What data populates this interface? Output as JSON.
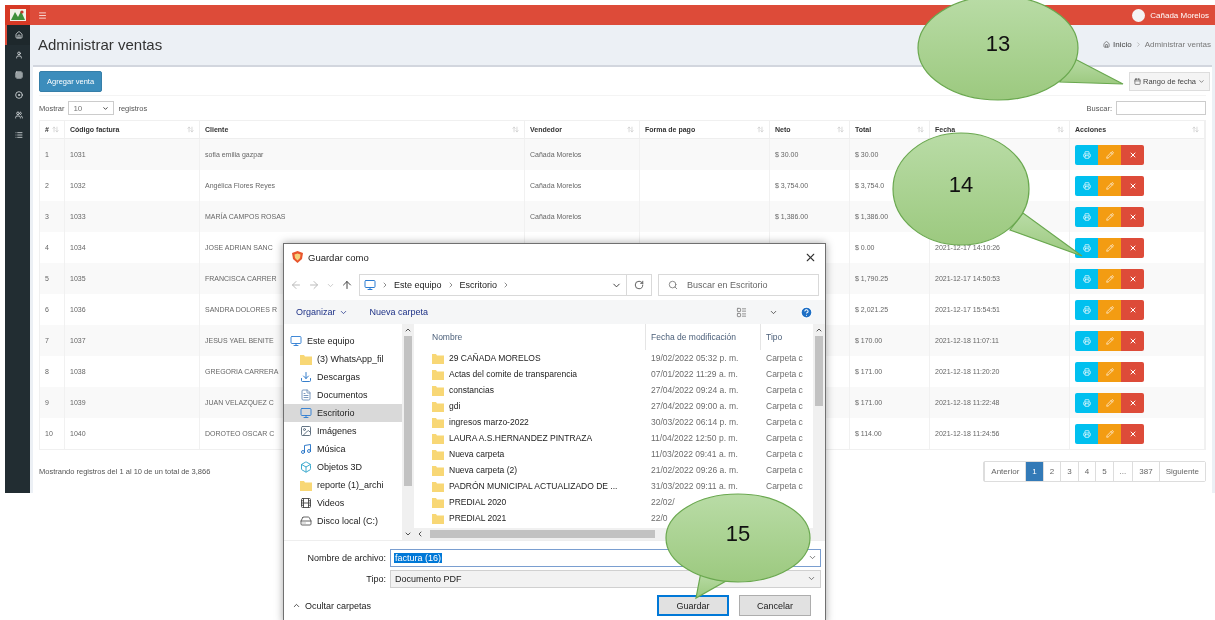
{
  "header": {
    "user": "Cañada Morelos"
  },
  "sidebar": {
    "items": [
      {
        "kind": "home",
        "selected": true
      },
      {
        "kind": "user",
        "selected": false
      },
      {
        "kind": "grid",
        "selected": false
      },
      {
        "kind": "disc",
        "selected": false
      },
      {
        "kind": "users",
        "selected": false
      },
      {
        "kind": "list",
        "selected": false
      }
    ]
  },
  "page": {
    "title": "Administrar ventas",
    "breadcrumb": [
      "Inicio",
      "Administrar ventas"
    ]
  },
  "toolbar": {
    "add_button": "Agregar venta",
    "date_range_button": "Rango de fecha"
  },
  "table_controls": {
    "show_label": "Mostrar",
    "page_size": "10",
    "records_label": "registros",
    "search_label": "Buscar:"
  },
  "table": {
    "columns": [
      "#",
      "Código factura",
      "Cliente",
      "Vendedor",
      "Forma de pago",
      "Neto",
      "Total",
      "Fecha",
      "Acciones"
    ],
    "rows": [
      {
        "number": "1",
        "code": "1031",
        "client": "sofia emilia gazpar",
        "seller": "Cañada Morelos",
        "net": "$ 30.00",
        "total": "$ 30.00"
      },
      {
        "number": "2",
        "code": "1032",
        "client": "Angélica Flores Reyes",
        "seller": "Cañada Morelos",
        "net": "$ 3,754.00",
        "total": "$ 3,754.0"
      },
      {
        "number": "3",
        "code": "1033",
        "client": "MARÍA CAMPOS ROSAS",
        "seller": "Cañada Morelos",
        "net": "$ 1,386.00",
        "total": "$ 1,386.00"
      },
      {
        "number": "4",
        "code": "1034",
        "client": "JOSE ADRIAN SANC",
        "total": "$ 0.00",
        "date": "2021-12-17 14:10:26"
      },
      {
        "number": "5",
        "code": "1035",
        "client": "FRANCISCA CARRER",
        "total": "$ 1,790.25",
        "date": "2021-12-17 14:50:53"
      },
      {
        "number": "6",
        "code": "1036",
        "client": "SANDRA DOLORES R",
        "total": "$ 2,021.25",
        "date": "2021-12-17 15:54:51"
      },
      {
        "number": "7",
        "code": "1037",
        "client": "JESUS YAEL BENITE",
        "total": "$ 170.00",
        "date": "2021-12-18 11:07:11"
      },
      {
        "number": "8",
        "code": "1038",
        "client": "GREGORIA CARRERA",
        "total": "$ 171.00",
        "date": "2021-12-18 11:20:20"
      },
      {
        "number": "9",
        "code": "1039",
        "client": "JUAN VELAZQUEZ C",
        "total": "$ 171.00",
        "date": "2021-12-18 11:22:48"
      },
      {
        "number": "10",
        "code": "1040",
        "client": "DOROTEO OSCAR C",
        "total": "$ 114.00",
        "date": "2021-12-18 11:24:56"
      }
    ]
  },
  "footer": {
    "info": "Mostrando registros del 1 al 10 de un total de 3,866",
    "pagination": [
      {
        "label": "Anterior",
        "selected": false
      },
      {
        "label": "1",
        "selected": true
      },
      {
        "label": "2",
        "selected": false
      },
      {
        "label": "3",
        "selected": false
      },
      {
        "label": "4",
        "selected": false
      },
      {
        "label": "5",
        "selected": false
      },
      {
        "label": "...",
        "selected": false
      },
      {
        "label": "387",
        "selected": false
      },
      {
        "label": "Siguiente",
        "selected": false
      }
    ]
  },
  "dialog": {
    "title": "Guardar como",
    "path": [
      "Este equipo",
      "Escritorio"
    ],
    "search_placeholder": "Buscar en Escritorio",
    "organize": "Organizar",
    "new_folder": "Nueva carpeta",
    "nav": [
      {
        "label": "Este equipo",
        "kind": "pc",
        "selected": false,
        "children": [
          {
            "label": "(3) WhatsApp_fil",
            "kind": "folder",
            "selected": false
          },
          {
            "label": "Descargas",
            "kind": "download",
            "selected": false
          },
          {
            "label": "Documentos",
            "kind": "document",
            "selected": false
          },
          {
            "label": "Escritorio",
            "kind": "desktop",
            "selected": true
          },
          {
            "label": "Imágenes",
            "kind": "pictures",
            "selected": false
          },
          {
            "label": "Música",
            "kind": "music",
            "selected": false
          },
          {
            "label": "Objetos 3D",
            "kind": "objects",
            "selected": false
          },
          {
            "label": "reporte (1)_archi",
            "kind": "folder",
            "selected": false
          },
          {
            "label": "Videos",
            "kind": "video",
            "selected": false
          },
          {
            "label": "Disco local (C:)",
            "kind": "drive",
            "selected": false
          }
        ]
      }
    ],
    "columns": [
      "Nombre",
      "Fecha de modificación",
      "Tipo"
    ],
    "files": [
      {
        "name": "29 CAÑADA MORELOS",
        "modified": "19/02/2022 05:32 p. m.",
        "type": "Carpeta c"
      },
      {
        "name": "Actas del comite de transparencia",
        "modified": "07/01/2022 11:29 a. m.",
        "type": "Carpeta c"
      },
      {
        "name": "constancias",
        "modified": "27/04/2022 09:24 a. m.",
        "type": "Carpeta c"
      },
      {
        "name": "gdi",
        "modified": "27/04/2022 09:00 a. m.",
        "type": "Carpeta c"
      },
      {
        "name": "ingresos marzo-2022",
        "modified": "30/03/2022 06:14 p. m.",
        "type": "Carpeta c"
      },
      {
        "name": "LAURA A.S.HERNANDEZ PINTRAZA",
        "modified": "11/04/2022 12:50 p. m.",
        "type": "Carpeta c"
      },
      {
        "name": "Nueva carpeta",
        "modified": "11/03/2022 09:41 a. m.",
        "type": "Carpeta c"
      },
      {
        "name": "Nueva carpeta (2)",
        "modified": "21/02/2022 09:26 a. m.",
        "type": "Carpeta c"
      },
      {
        "name": "PADRÓN MUNICIPAL ACTUALIZADO DE ...",
        "modified": "31/03/2022 09:11 a. m.",
        "type": "Carpeta c"
      },
      {
        "name": "PREDIAL 2020",
        "modified": "22/02/"
      },
      {
        "name": "PREDIAL 2021",
        "modified": "22/0"
      }
    ],
    "filename_label": "Nombre de archivo:",
    "filename": "factura (16)",
    "type_label": "Tipo:",
    "type": "Documento PDF",
    "hide_folders": "Ocultar carpetas",
    "buttons": [
      {
        "label": "Guardar",
        "kind": "primary"
      },
      {
        "label": "Cancelar",
        "kind": "secondary"
      }
    ]
  },
  "callouts": [
    "13",
    "14",
    "15"
  ]
}
